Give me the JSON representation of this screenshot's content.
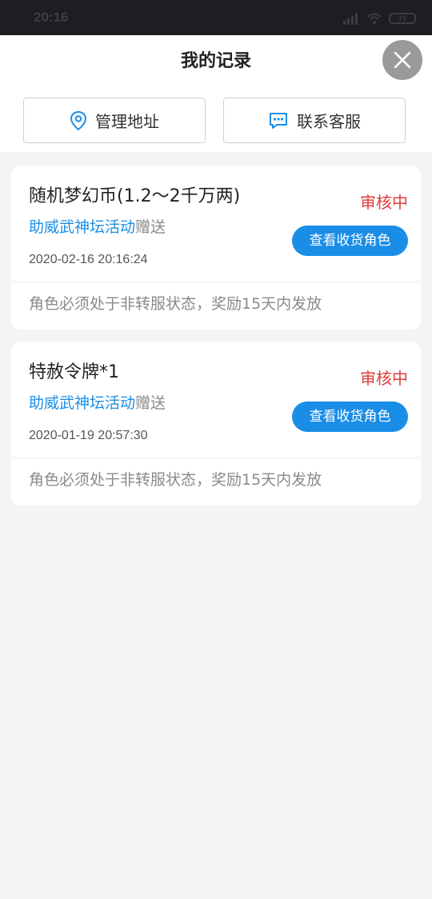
{
  "status_bar": {
    "time": "20:16",
    "battery": "71"
  },
  "header": {
    "title": "我的记录"
  },
  "actions": {
    "manage_address": "管理地址",
    "contact_service": "联系客服"
  },
  "records": [
    {
      "title": "随机梦幻币(1.2～2千万两)",
      "status": "审核中",
      "activity": "助威武神坛活动",
      "activity_suffix": "赠送",
      "date": "2020-02-16 20:16:24",
      "button": "查看收货角色",
      "note": "角色必须处于非转服状态，奖励15天内发放"
    },
    {
      "title": "特赦令牌*1",
      "status": "审核中",
      "activity": "助威武神坛活动",
      "activity_suffix": "赠送",
      "date": "2020-01-19 20:57:30",
      "button": "查看收货角色",
      "note": "角色必须处于非转服状态，奖励15天内发放"
    }
  ],
  "colors": {
    "accent_blue": "#1a8ee6",
    "status_red": "#e23b3b",
    "background": "#f4f4f4"
  },
  "icons": {
    "close": "close-icon",
    "address": "location-pin-icon",
    "service": "chat-bubble-icon",
    "signal": "signal-icon",
    "wifi": "wifi-icon"
  }
}
